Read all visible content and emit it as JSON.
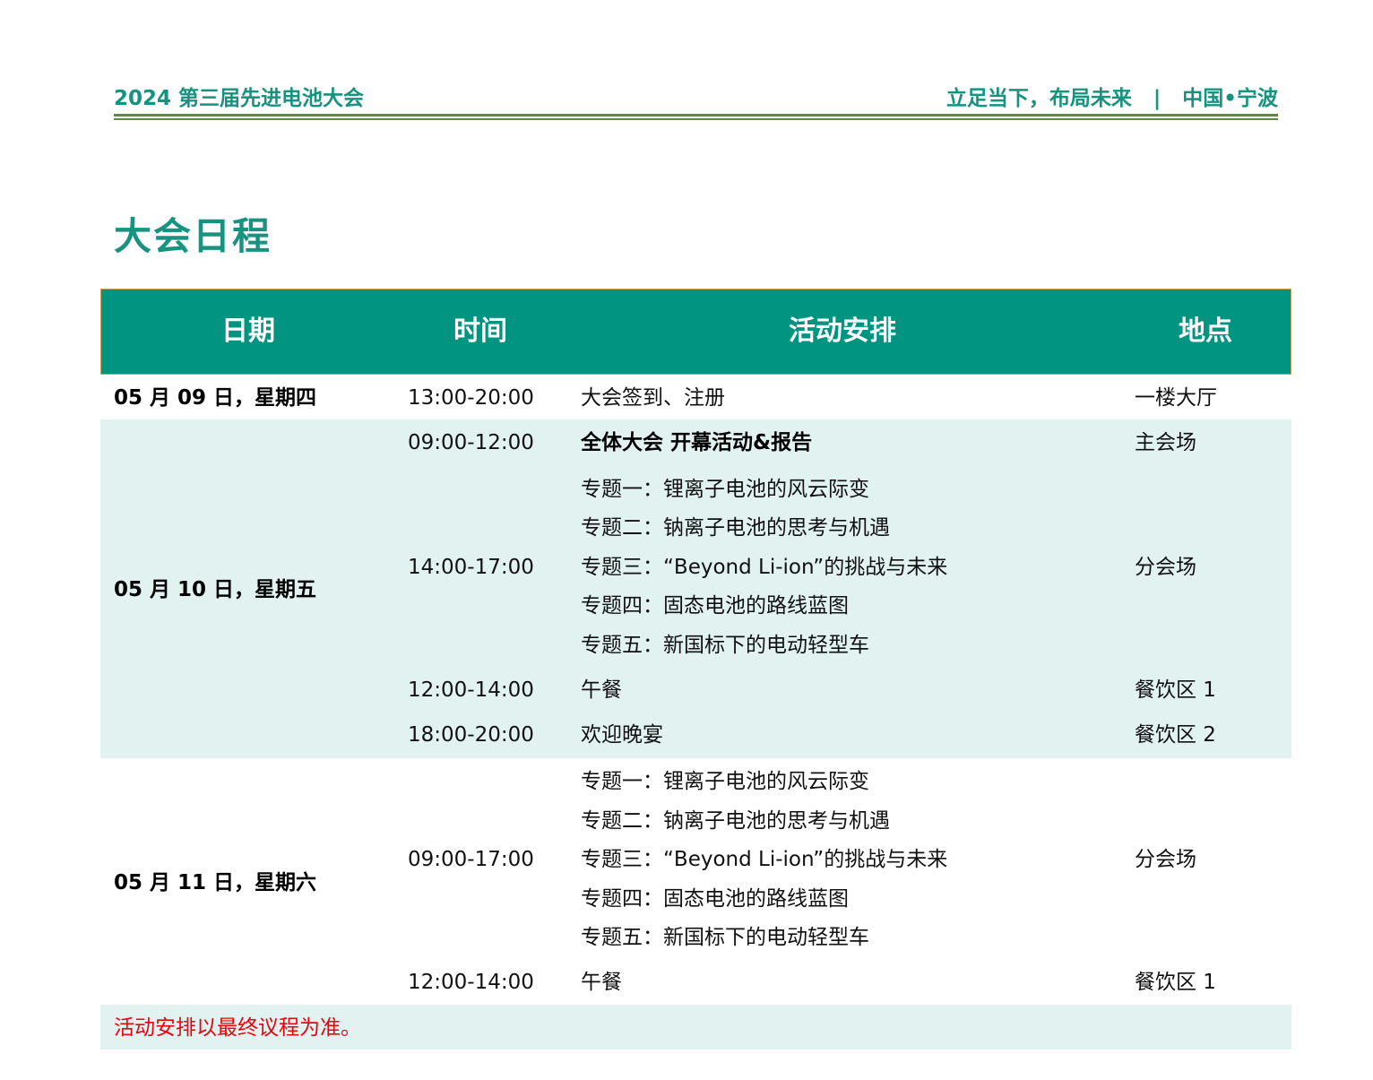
{
  "header": {
    "left": "2024 第三届先进电池大会",
    "right": "立足当下，布局未来   |   中国•宁波"
  },
  "title": "大会日程",
  "table": {
    "columns": [
      "日期",
      "时间",
      "活动安排",
      "地点"
    ],
    "days": [
      {
        "date": "05 月 09 日，星期四",
        "rows": [
          {
            "time": "13:00-20:00",
            "activities": [
              "大会签到、注册"
            ],
            "location": "一楼大厅"
          }
        ]
      },
      {
        "date": "05 月 10 日，星期五",
        "rows": [
          {
            "time": "09:00-12:00",
            "activities": [
              "全体大会  开幕活动&报告"
            ],
            "location": "主会场"
          },
          {
            "time": "14:00-17:00",
            "activities": [
              "专题一：锂离子电池的风云际变",
              "专题二：钠离子电池的思考与机遇",
              "专题三：“Beyond Li-ion”的挑战与未来",
              "专题四：固态电池的路线蓝图",
              "专题五：新国标下的电动轻型车"
            ],
            "location": "分会场"
          },
          {
            "time": "12:00-14:00",
            "activities": [
              "午餐"
            ],
            "location": "餐饮区 1"
          },
          {
            "time": "18:00-20:00",
            "activities": [
              "欢迎晚宴"
            ],
            "location": "餐饮区 2"
          }
        ]
      },
      {
        "date": "05 月 11 日，星期六",
        "rows": [
          {
            "time": "09:00-17:00",
            "activities": [
              "专题一：锂离子电池的风云际变",
              "专题二：钠离子电池的思考与机遇",
              "专题三：“Beyond Li-ion”的挑战与未来",
              "专题四：固态电池的路线蓝图",
              "专题五：新国标下的电动轻型车"
            ],
            "location": "分会场"
          },
          {
            "time": "12:00-14:00",
            "activities": [
              "午餐"
            ],
            "location": "餐饮区 1"
          }
        ]
      }
    ],
    "note": "活动安排以最终议程为准。"
  },
  "colors": {
    "brand_green": "#16937f",
    "header_bg": "#009481",
    "row_shade": "#e1f2f1",
    "rule": "#5f8a3c",
    "note_red": "#e4060f"
  }
}
